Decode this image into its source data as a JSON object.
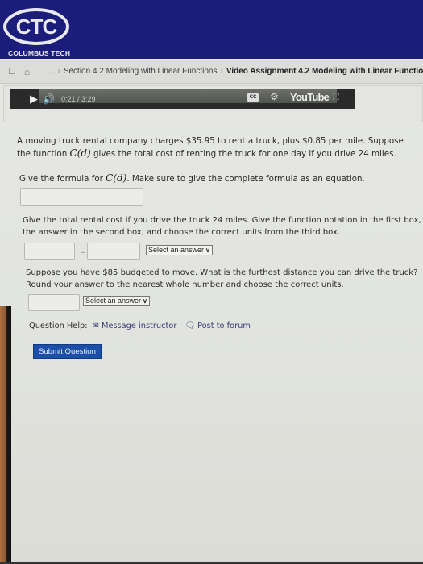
{
  "header": {
    "logo_text": "CTC",
    "logo_subtitle": "COLUMBUS TECH"
  },
  "breadcrumb": {
    "icons": [
      "window-icon",
      "home-icon"
    ],
    "ellipsis": "...",
    "separator": "›",
    "items": [
      {
        "label": "Section 4.2 Modeling with Linear Functions"
      },
      {
        "label": "Video Assignment 4.2 Modeling with Linear Functio"
      }
    ]
  },
  "video": {
    "current_time": "0:21",
    "duration": "3:29",
    "time_display": "0:21 / 3:29",
    "cc_label": "CC",
    "brand": "YouTube",
    "icons": [
      "play-icon",
      "volume-icon",
      "cc-icon",
      "gear-icon",
      "fullscreen-icon"
    ]
  },
  "question": {
    "intro_part1": "A moving truck rental company charges $35.95 to rent a truck, plus $0.85 per mile. Suppose the function ",
    "intro_math": "C(d)",
    "intro_part2": " gives the total cost of renting the truck for one day if you drive 24 miles.",
    "part1": {
      "prompt_before": "Give the formula for ",
      "prompt_math": "C(d)",
      "prompt_after": ". Make sure to give the complete formula as an equation.",
      "input_value": ""
    },
    "part2": {
      "prompt": "Give the total rental cost if you drive the truck 24 miles. Give the function notation in the first box, the answer in the second box, and choose the correct units from the third box.",
      "input1_value": "",
      "equals": "=",
      "input2_value": "",
      "select_value": "Select an answer"
    },
    "part3": {
      "prompt": "Suppose you have $85 budgeted to move. What is the furthest distance you can drive the truck? Round your answer to the nearest whole number and choose the correct units.",
      "input_value": "",
      "select_value": "Select an answer"
    },
    "help": {
      "label": "Question Help:",
      "message_link": "Message instructor",
      "forum_link": "Post to forum"
    },
    "submit_label": "Submit Question"
  },
  "colors": {
    "header_bg": "#1c1d7a",
    "submit_bg": "#1c4fa8",
    "link": "#3b3b7a"
  }
}
